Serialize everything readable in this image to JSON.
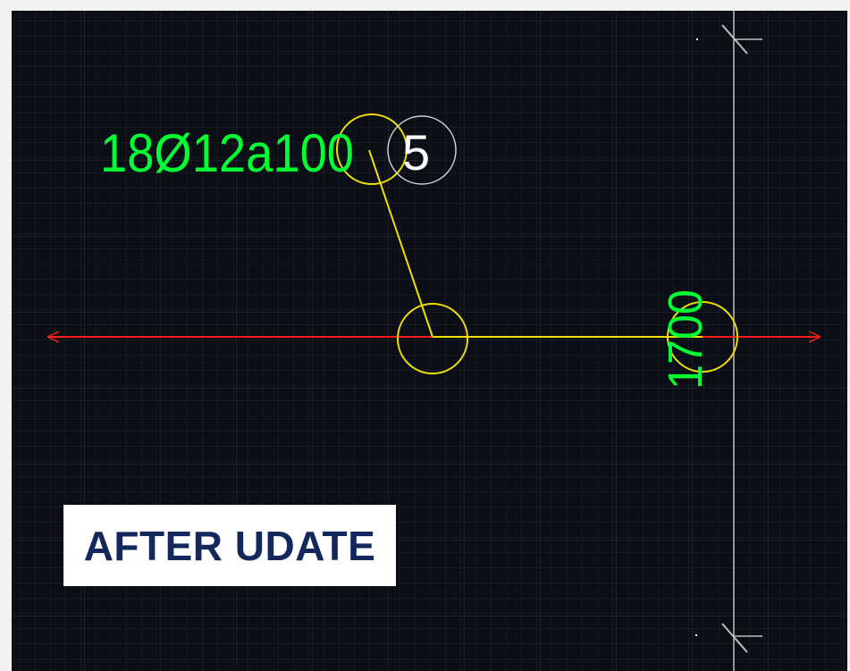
{
  "drawing": {
    "rebar_label": "18Ø12a100",
    "bar_mark": "5",
    "dimension_value": "1700"
  },
  "caption": {
    "text": "AFTER UDATE"
  },
  "colors": {
    "background": "#0b0e14",
    "grid_minor": "#1f2430",
    "grid_major": "#2a3040",
    "rebar_line": "#ff1a1a",
    "leader": "#f0e000",
    "text_green": "#00ff33",
    "text_white": "#ffffff",
    "dimension_line": "#bfbfbf",
    "caption_bg": "#ffffff",
    "caption_text": "#14285e"
  },
  "icons": {
    "arrow_left": "arrow-left-icon",
    "arrow_right": "arrow-right-icon",
    "tick_top": "dimension-tick-icon",
    "tick_bottom": "dimension-tick-icon"
  }
}
